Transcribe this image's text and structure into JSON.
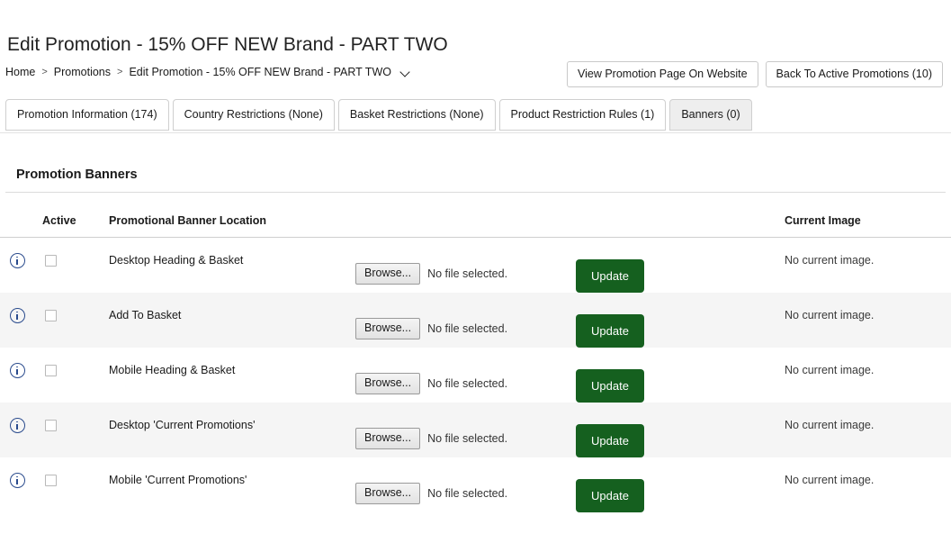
{
  "page": {
    "title": "Edit Promotion - 15% OFF NEW Brand - PART TWO"
  },
  "breadcrumb": {
    "items": [
      {
        "label": "Home"
      },
      {
        "label": "Promotions"
      },
      {
        "label": "Edit Promotion - 15% OFF NEW Brand - PART TWO"
      }
    ],
    "separator": ">"
  },
  "top_actions": {
    "view_promotion_label": "View Promotion Page On Website",
    "back_label": "Back To Active Promotions (10)"
  },
  "tabs": [
    {
      "label": "Promotion Information (174)",
      "active": false
    },
    {
      "label": "Country Restrictions (None)",
      "active": false
    },
    {
      "label": "Basket Restrictions (None)",
      "active": false
    },
    {
      "label": "Product Restriction Rules (1)",
      "active": false
    },
    {
      "label": "Banners (0)",
      "active": true
    }
  ],
  "section": {
    "title": "Promotion Banners"
  },
  "table": {
    "headers": {
      "active": "Active",
      "location": "Promotional Banner Location",
      "current_image": "Current Image"
    },
    "browse_label": "Browse...",
    "file_status": "No file selected.",
    "update_label": "Update",
    "rows": [
      {
        "location": "Desktop Heading & Basket",
        "current_image": "No current image."
      },
      {
        "location": "Add To Basket",
        "current_image": "No current image."
      },
      {
        "location": "Mobile Heading & Basket",
        "current_image": "No current image."
      },
      {
        "location": "Desktop 'Current Promotions'",
        "current_image": "No current image."
      },
      {
        "location": "Mobile 'Current Promotions'",
        "current_image": "No current image."
      }
    ]
  },
  "colors": {
    "update_green": "#15601f",
    "info_blue": "#2a4b8d",
    "active_tab_bg": "#eeeeee",
    "stripe_bg": "#f5f5f5"
  }
}
